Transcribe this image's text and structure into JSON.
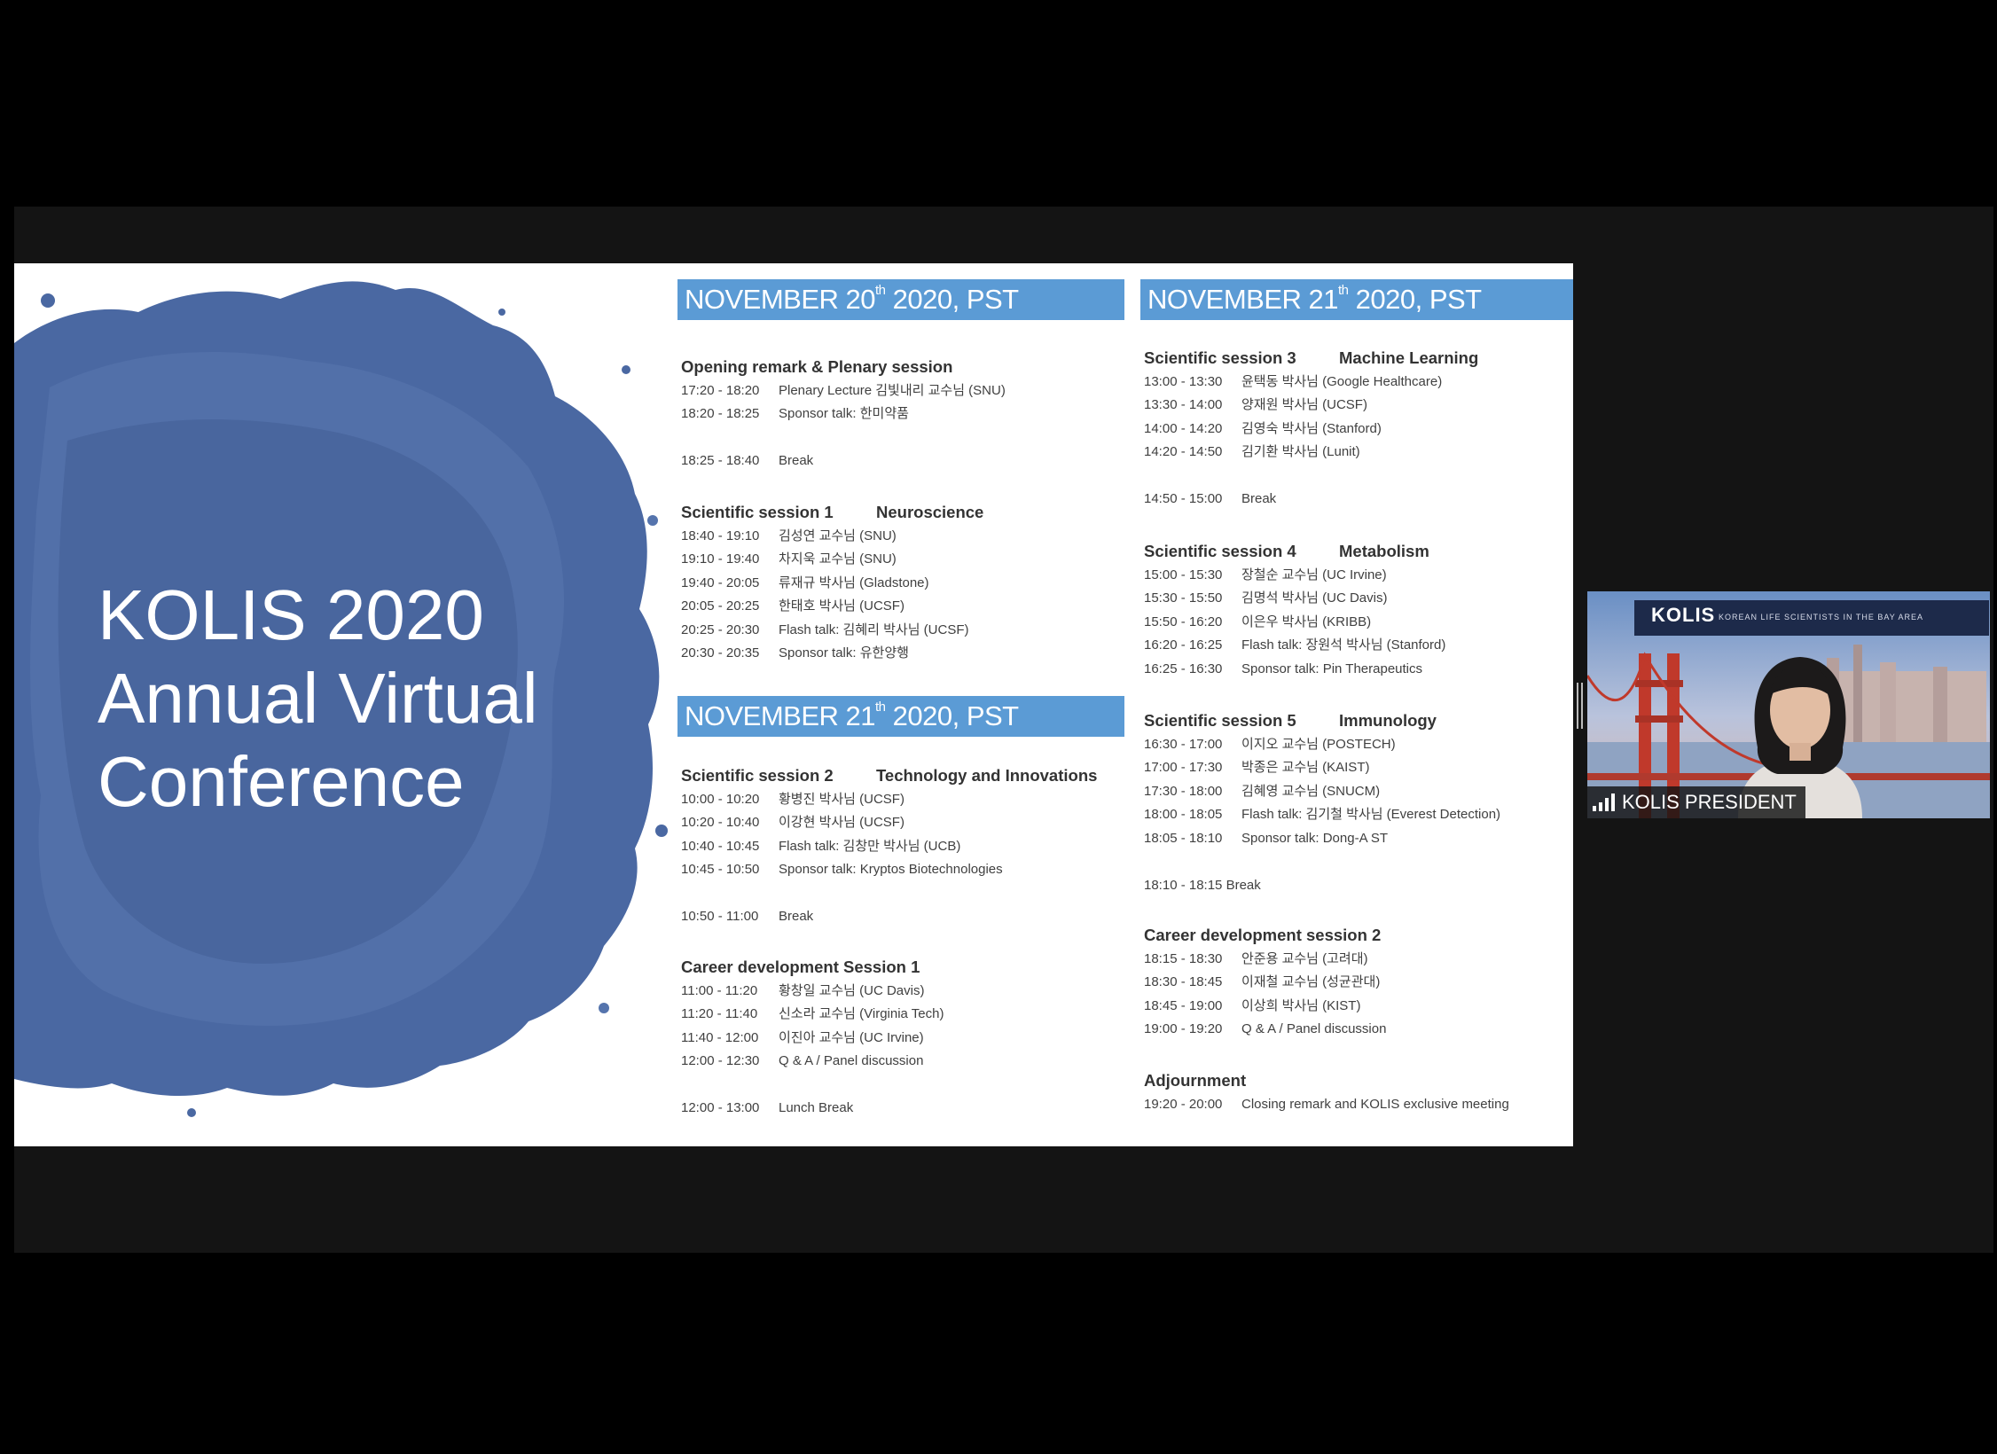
{
  "slide": {
    "title_lines": [
      "KOLIS 2020",
      "Annual Virtual",
      "Conference"
    ],
    "day1": {
      "month": "NOVEMBER 20",
      "ordinal": "th",
      "rest": " 2020, PST",
      "sessions": [
        {
          "title": "Opening remark & Plenary session",
          "topic": "",
          "rows": [
            {
              "time": "17:20 - 18:20",
              "desc": "Plenary Lecture 김빛내리 교수님 (SNU)"
            },
            {
              "time": "18:20 - 18:25",
              "desc": "Sponsor talk: 한미약품"
            }
          ]
        },
        {
          "title": "",
          "topic": "",
          "rows": [
            {
              "time": "18:25 - 18:40",
              "desc": "Break"
            }
          ]
        },
        {
          "title": "Scientific session 1",
          "topic": "Neuroscience",
          "rows": [
            {
              "time": "18:40 - 19:10",
              "desc": "김성연 교수님 (SNU)"
            },
            {
              "time": "19:10 - 19:40",
              "desc": "차지욱 교수님 (SNU)"
            },
            {
              "time": "19:40 - 20:05",
              "desc": "류재규 박사님 (Gladstone)"
            },
            {
              "time": "20:05 - 20:25",
              "desc": "한태호 박사님 (UCSF)"
            },
            {
              "time": "20:25 - 20:30",
              "desc": "Flash talk: 김혜리 박사님 (UCSF)"
            },
            {
              "time": "20:30 - 20:35",
              "desc": "Sponsor talk: 유한양행"
            }
          ]
        }
      ]
    },
    "day2a": {
      "month": "NOVEMBER 21",
      "ordinal": "th",
      "rest": " 2020, PST",
      "sessions": [
        {
          "title": "Scientific session 2",
          "topic": "Technology and Innovations",
          "rows": [
            {
              "time": "10:00 - 10:20",
              "desc": "황병진 박사님 (UCSF)"
            },
            {
              "time": "10:20 - 10:40",
              "desc": "이강현 박사님 (UCSF)"
            },
            {
              "time": "10:40 - 10:45",
              "desc": "Flash talk: 김창만 박사님 (UCB)"
            },
            {
              "time": "10:45 - 10:50",
              "desc": "Sponsor talk: Kryptos Biotechnologies"
            }
          ]
        },
        {
          "title": "",
          "topic": "",
          "rows": [
            {
              "time": "10:50 - 11:00",
              "desc": "Break"
            }
          ]
        },
        {
          "title": "Career development Session 1",
          "topic": "",
          "rows": [
            {
              "time": "11:00 - 11:20",
              "desc": "황창일 교수님 (UC Davis)"
            },
            {
              "time": "11:20 - 11:40",
              "desc": "신소라 교수님 (Virginia Tech)"
            },
            {
              "time": "11:40 - 12:00",
              "desc": "이진아 교수님 (UC Irvine)"
            },
            {
              "time": "12:00 - 12:30",
              "desc": "Q & A / Panel discussion"
            }
          ]
        },
        {
          "title": "",
          "topic": "",
          "rows": [
            {
              "time": "12:00 - 13:00",
              "desc": "Lunch Break"
            }
          ]
        }
      ]
    },
    "day2b": {
      "month": "NOVEMBER 21",
      "ordinal": "th",
      "rest": " 2020, PST",
      "sessions": [
        {
          "title": "Scientific session 3",
          "topic": "Machine Learning",
          "rows": [
            {
              "time": "13:00 - 13:30",
              "desc": "윤택동 박사님 (Google Healthcare)"
            },
            {
              "time": "13:30 - 14:00",
              "desc": "양재원 박사님 (UCSF)"
            },
            {
              "time": "14:00 - 14:20",
              "desc": "김영숙 박사님 (Stanford)"
            },
            {
              "time": "14:20 - 14:50",
              "desc": "김기환 박사님 (Lunit)"
            }
          ]
        },
        {
          "title": "",
          "topic": "",
          "rows": [
            {
              "time": "14:50 - 15:00",
              "desc": "Break"
            }
          ]
        },
        {
          "title": "Scientific session 4",
          "topic": "Metabolism",
          "rows": [
            {
              "time": "15:00 - 15:30",
              "desc": "장철순 교수님 (UC Irvine)"
            },
            {
              "time": "15:30 - 15:50",
              "desc": "김명석 박사님 (UC Davis)"
            },
            {
              "time": "15:50 - 16:20",
              "desc": "이은우 박사님 (KRIBB)"
            },
            {
              "time": "16:20 - 16:25",
              "desc": "Flash talk: 장원석 박사님 (Stanford)"
            },
            {
              "time": "16:25 - 16:30",
              "desc": "Sponsor talk: Pin Therapeutics"
            }
          ]
        },
        {
          "title": "Scientific session 5",
          "topic": "Immunology",
          "rows": [
            {
              "time": "16:30 - 17:00",
              "desc": "이지오 교수님 (POSTECH)"
            },
            {
              "time": "17:00 - 17:30",
              "desc": "박종은 교수님 (KAIST)"
            },
            {
              "time": "17:30 - 18:00",
              "desc": "김혜영 교수님 (SNUCM)"
            },
            {
              "time": "18:00 - 18:05",
              "desc": "Flash talk: 김기철 박사님 (Everest Detection)"
            },
            {
              "time": "18:05 - 18:10",
              "desc": "Sponsor talk: Dong-A ST"
            }
          ]
        },
        {
          "title": "",
          "topic": "",
          "rows": [
            {
              "time": "18:10 - 18:15 Break",
              "desc": ""
            }
          ]
        },
        {
          "title": "Career development session 2",
          "topic": "",
          "rows": [
            {
              "time": "18:15 - 18:30",
              "desc": "안준용 교수님 (고려대)"
            },
            {
              "time": "18:30 - 18:45",
              "desc": "이재철 교수님 (성균관대)"
            },
            {
              "time": "18:45 - 19:00",
              "desc": "이상희 박사님 (KIST)"
            },
            {
              "time": "19:00 - 19:20",
              "desc": "Q & A / Panel discussion"
            }
          ]
        },
        {
          "title": "Adjournment",
          "topic": "",
          "rows": [
            {
              "time": "19:20 - 20:00",
              "desc": "Closing remark and KOLIS exclusive meeting"
            }
          ]
        }
      ]
    }
  },
  "video": {
    "participant_name": "KOLIS PRESIDENT",
    "banner_logo": "KOLIS",
    "banner_tagline": "KOREAN LIFE SCIENTISTS IN THE BAY AREA"
  },
  "colors": {
    "date_bar": "#5b9bd5",
    "splash": "#4a68a2",
    "background": "#000000"
  }
}
